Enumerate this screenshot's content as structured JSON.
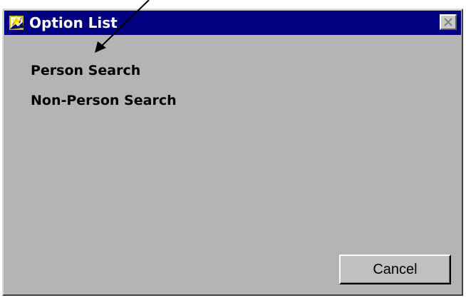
{
  "window": {
    "title": "Option List",
    "title_bar_color": "#000080",
    "body_color": "#b4b4b4",
    "app_icon": "app-icon",
    "close_icon": "close-icon"
  },
  "options": [
    {
      "label": "Person Search"
    },
    {
      "label": "Non-Person Search"
    }
  ],
  "buttons": {
    "cancel_label": "Cancel"
  },
  "annotation": {
    "type": "arrow",
    "points_to": "Person Search"
  }
}
